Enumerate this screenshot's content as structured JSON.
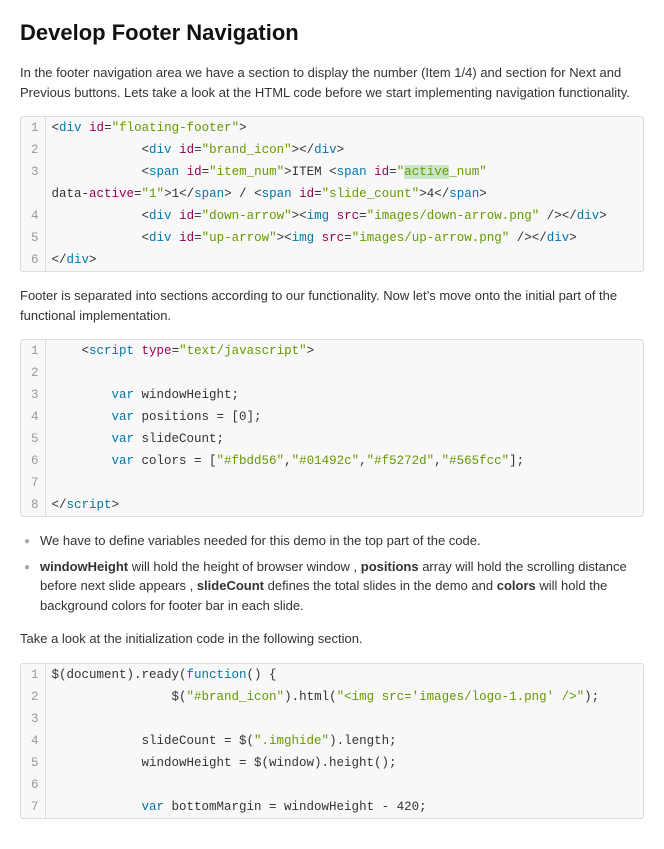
{
  "title": "Develop Footer Navigation",
  "intro": "In the footer navigation area we have a section to display the number (Item 1/4) and section for Next and Previous buttons. Lets take a look at the HTML code before we start implementing navigation functionality.",
  "code_block_1": {
    "lines": [
      {
        "num": 1,
        "html": "<span class='plain'>&lt;</span><span class='tag'>div</span> <span class='attr'>id</span>=<span class='str'>\"floating-footer\"</span><span class='plain'>&gt;</span>"
      },
      {
        "num": 2,
        "html": "<span class='plain'>            &lt;</span><span class='tag'>div</span> <span class='attr'>id</span>=<span class='str'>\"brand_icon\"</span><span class='plain'>&gt;&lt;/</span><span class='tag'>div</span><span class='plain'>&gt;</span>"
      },
      {
        "num": 3,
        "html": "<span class='plain'>            &lt;</span><span class='tag'>span</span> <span class='attr'>id</span>=<span class='str'>\"item_num\"</span><span class='plain'>&gt;ITEM &lt;</span><span class='tag'>span</span> <span class='attr'>id</span>=<span class='str'>\"active_num\"</span></span>"
      },
      {
        "num": "",
        "html": "<span class='plain'>data-active=</span><span class='str'>\"1\"</span><span class='plain'>&gt;1&lt;/</span><span class='tag'>span</span><span class='plain'>&gt; / &lt;</span><span class='tag'>span</span> <span class='attr'>id</span>=<span class='str'>\"slide_count\"</span><span class='plain'>&gt;4&lt;/</span><span class='tag'>span</span><span class='plain'>&gt;</span>"
      },
      {
        "num": 4,
        "html": "<span class='plain'>            &lt;</span><span class='tag'>div</span> <span class='attr'>id</span>=<span class='str'>\"down-arrow\"</span><span class='plain'>&gt;&lt;</span><span class='tag'>img</span> <span class='attr'>src</span>=<span class='str'>\"images/down-arrow.png\"</span> <span class='plain'>/&gt;&lt;/</span><span class='tag'>div</span><span class='plain'>&gt;</span>"
      },
      {
        "num": 5,
        "html": "<span class='plain'>            &lt;</span><span class='tag'>div</span> <span class='attr'>id</span>=<span class='str'>\"up-arrow\"</span><span class='plain'>&gt;&lt;</span><span class='tag'>img</span> <span class='attr'>src</span>=<span class='str'>\"images/up-arrow.png\"</span> <span class='plain'>/&gt;&lt;/</span><span class='tag'>div</span><span class='plain'>&gt;</span>"
      },
      {
        "num": 6,
        "html": "<span class='plain'>&lt;/</span><span class='tag'>div</span><span class='plain'>&gt;</span>"
      }
    ]
  },
  "mid_text": "Footer is separated into sections according to our functionality. Now let’s move onto the initial part of the functional implementation.",
  "code_block_2": {
    "lines": [
      {
        "num": 1,
        "html": "<span class='plain'>    &lt;</span><span class='tag'>script</span> <span class='attr'>type</span>=<span class='str'>\"text/javascript\"</span><span class='plain'>&gt;</span>"
      },
      {
        "num": 2,
        "html": ""
      },
      {
        "num": 3,
        "html": "<span class='plain'>        </span><span class='kw-var'>var</span><span class='plain'> windowHeight;</span>"
      },
      {
        "num": 4,
        "html": "<span class='plain'>        </span><span class='kw-var'>var</span><span class='plain'> positions = [0];</span>"
      },
      {
        "num": 5,
        "html": "<span class='plain'>        </span><span class='kw-var'>var</span><span class='plain'> slideCount;</span>"
      },
      {
        "num": 6,
        "html": "<span class='plain'>        </span><span class='kw-var'>var</span><span class='plain'> colors = [</span><span class='str'>\"#fbdd56\"</span><span class='plain'>,</span><span class='str'>\"#01492c\"</span><span class='plain'>,</span><span class='str'>\"#f5272d\"</span><span class='plain'>,</span><span class='str'>\"#565fcc\"</span><span class='plain'>];</span>"
      },
      {
        "num": 7,
        "html": ""
      },
      {
        "num": 8,
        "html": "<span class='plain'>&lt;/</span><span class='tag'>script</span><span class='plain'>&gt;</span>"
      }
    ]
  },
  "bullet_1": "We have to define variables needed for this demo in the top part of the code.",
  "bullet_2_parts": {
    "pre": "",
    "bold1": "windowHeight",
    "mid1": " will hold the height of browser window , ",
    "bold2": "positions",
    "mid2": " array will hold the scrolling distance before next slide appears , ",
    "bold3": "slideCount",
    "mid3": " defines the total slides in the demo and ",
    "bold4": "colors",
    "mid4": " will hold the background colors for footer bar in each slide."
  },
  "take_look_text": "Take a look at the initialization code in the following section.",
  "code_block_3": {
    "lines": [
      {
        "num": 1,
        "html": "<span class='plain'>$(document).ready(</span><span class='kw-var'>function</span><span class='plain'>() {</span>"
      },
      {
        "num": 2,
        "html": "<span class='plain'>                $(</span><span class='str'>\"#brand_icon\"</span><span class='plain'>).html(</span><span class='str'>\"&lt;img src='images/logo-1.png' /&gt;\"</span><span class='plain'>);</span>"
      },
      {
        "num": 3,
        "html": ""
      },
      {
        "num": 4,
        "html": "<span class='plain'>            slideCount = $(</span><span class='str'>\".imghide\"</span><span class='plain'>).length;</span>"
      },
      {
        "num": 5,
        "html": "<span class='plain'>            windowHeight = $(window).height();</span>"
      },
      {
        "num": 6,
        "html": ""
      },
      {
        "num": 7,
        "html": "<span class='plain'>            </span><span class='kw-var'>var</span><span class='plain'> bottomMargin = windowHeight - 420;</span>"
      }
    ]
  }
}
